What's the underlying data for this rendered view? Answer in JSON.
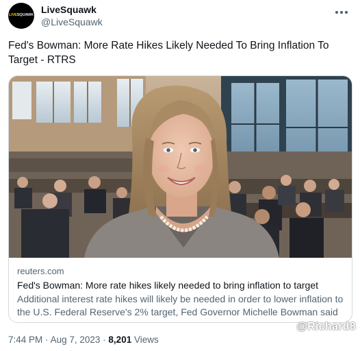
{
  "account": {
    "display_name": "LiveSquawk",
    "handle": "@LiveSquawk",
    "avatar_logo_part1": "LIVE",
    "avatar_logo_part2": "SQUAWK"
  },
  "tweet": {
    "text": "Fed's Bowman: More Rate Hikes Likely Needed To Bring Inflation To Target - RTRS"
  },
  "card": {
    "domain": "reuters.com",
    "title": "Fed's Bowman: More rate hikes likely needed to bring inflation to target",
    "description": "Additional interest rate hikes will likely be needed in order to lower inflation to the U.S. Federal Reserve's 2% target, Fed Governor Michelle Bowman said on ..."
  },
  "meta": {
    "time": "7:44 PM",
    "separator": "·",
    "date": "Aug 7, 2023",
    "views_count": "8,201",
    "views_label": "Views"
  },
  "watermark": "@Richard8",
  "icons": {
    "more": "more-horizontal-icon"
  }
}
